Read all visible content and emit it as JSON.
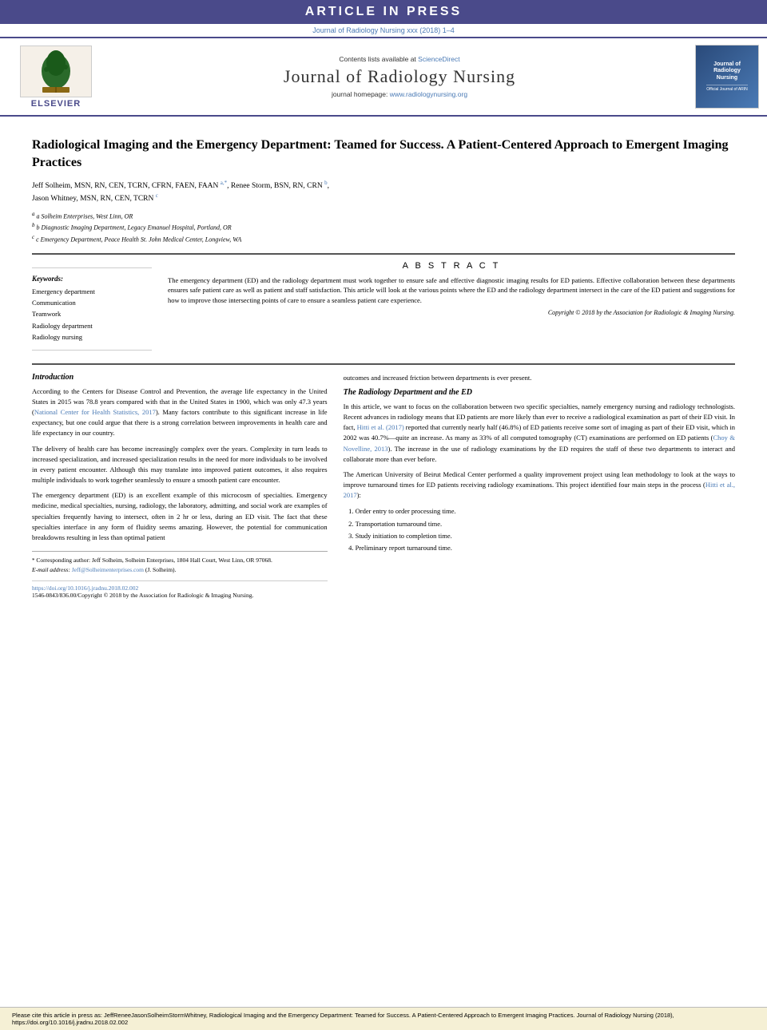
{
  "banner": {
    "text": "ARTICLE IN PRESS"
  },
  "journal_line": {
    "text": "Journal of Radiology Nursing xxx (2018) 1–4"
  },
  "header": {
    "contents_text": "Contents lists available at ",
    "contents_link": "ScienceDirect",
    "journal_title": "Journal of Radiology Nursing",
    "homepage_text": "journal homepage: ",
    "homepage_link": "www.radiologynursing.org",
    "elsevier_text": "ELSEVIER",
    "logo_text": "Radiology Nursing"
  },
  "article": {
    "title": "Radiological Imaging and the Emergency Department: Teamed for Success. A Patient-Centered Approach to Emergent Imaging Practices",
    "authors": "Jeff Solheim, MSN, RN, CEN, TCRN, CFRN, FAEN, FAAN a,*, Renee Storm, BSN, RN, CRN b, Jason Whitney, MSN, RN, CEN, TCRN c",
    "affiliations": [
      "a Solheim Enterprises, West Linn, OR",
      "b Diagnostic Imaging Department, Legacy Emanuel Hospital, Portland, OR",
      "c Emergency Department, Peace Health St. John Medical Center, Longview, WA"
    ]
  },
  "keywords": {
    "title": "Keywords:",
    "items": [
      "Emergency department",
      "Communication",
      "Teamwork",
      "Radiology department",
      "Radiology nursing"
    ]
  },
  "abstract": {
    "title": "A B S T R A C T",
    "text": "The emergency department (ED) and the radiology department must work together to ensure safe and effective diagnostic imaging results for ED patients. Effective collaboration between these departments ensures safe patient care as well as patient and staff satisfaction. This article will look at the various points where the ED and the radiology department intersect in the care of the ED patient and suggestions for how to improve those intersecting points of care to ensure a seamless patient care experience.",
    "copyright": "Copyright © 2018 by the Association for Radiologic & Imaging Nursing."
  },
  "introduction": {
    "heading": "Introduction",
    "paragraphs": [
      "According to the Centers for Disease Control and Prevention, the average life expectancy in the United States in 2015 was 78.8 years compared with that in the United States in 1900, which was only 47.3 years (National Center for Health Statistics, 2017). Many factors contribute to this significant increase in life expectancy, but one could argue that there is a strong correlation between improvements in health care and life expectancy in our country.",
      "The delivery of health care has become increasingly complex over the years. Complexity in turn leads to increased specialization, and increased specialization results in the need for more individuals to be involved in every patient encounter. Although this may translate into improved patient outcomes, it also requires multiple individuals to work together seamlessly to ensure a smooth patient care encounter.",
      "The emergency department (ED) is an excellent example of this microcosm of specialties. Emergency medicine, medical specialties, nursing, radiology, the laboratory, admitting, and social work are examples of specialties frequently having to intersect, often in 2 hr or less, during an ED visit. The fact that these specialties interface in any form of fluidity seems amazing. However, the potential for communication breakdowns resulting in less than optimal patient"
    ]
  },
  "right_col": {
    "intro_continuation": "outcomes and increased friction between departments is ever present.",
    "radiology_heading": "The Radiology Department and the ED",
    "radiology_paragraphs": [
      "In this article, we want to focus on the collaboration between two specific specialties, namely emergency nursing and radiology technologists. Recent advances in radiology means that ED patients are more likely than ever to receive a radiological examination as part of their ED visit. In fact, Hitti et al. (2017) reported that currently nearly half (46.8%) of ED patients receive some sort of imaging as part of their ED visit, which in 2002 was 40.7%—quite an increase. As many as 33% of all computed tomography (CT) examinations are performed on ED patients (Choy & Novelline, 2013). The increase in the use of radiology examinations by the ED requires the staff of these two departments to interact and collaborate more than ever before.",
      "The American University of Beirut Medical Center performed a quality improvement project using lean methodology to look at the ways to improve turnaround times for ED patients receiving radiology examinations. This project identified four main steps in the process (Hitti et al., 2017):"
    ],
    "numbered_list": [
      "Order entry to order processing time.",
      "Transportation turnaround time.",
      "Study initiation to completion time.",
      "Preliminary report turnaround time."
    ]
  },
  "footnotes": {
    "star_note": "* Corresponding author: Jeff Solheim, Solheim Enterprises, 1804 Hall Court, West Linn, OR 97068.",
    "email_label": "E-mail address: ",
    "email_link": "Jeff@Solheimenterprises.com",
    "email_suffix": " (J. Solheim)."
  },
  "doi": {
    "doi_link": "https://doi.org/10.1016/j.jradnu.2018.02.002",
    "issn_text": "1546-0843/836.00/Copyright © 2018 by the Association for Radiologic & Imaging Nursing."
  },
  "citation_bar": {
    "text": "Please cite this article in press as: JeffReneeJasonSolheimStormWhitney, Radiological Imaging and the Emergency Department: Teamed for Success. A Patient-Centered Approach to Emergent Imaging Practices. Journal of Radiology Nursing (2018), https://doi.org/10.1016/j.jradnu.2018.02.002"
  }
}
